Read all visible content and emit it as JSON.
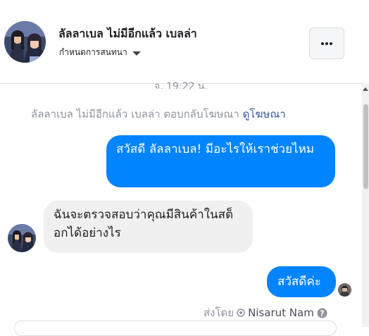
{
  "header": {
    "name": "ลัลลาเบล ไม่มีอีกแล้ว เบลล่า",
    "assign_label": "กำหนดการสนทนา",
    "more_icon": "more-horizontal-icon",
    "caret_icon": "caret-down-icon"
  },
  "thread": {
    "timestamp": "จ. 19:22 น.",
    "ad_reply_text": "ลัลลาเบล ไม่มีอีกแล้ว เบลล่า ตอบกลับโฆษณา",
    "ad_link": "ดูโฆษณา",
    "messages": [
      {
        "from": "page",
        "text": "สวัสดี ลัลลาเบล! มีอะไรให้เราช่วยไหม"
      },
      {
        "from": "customer",
        "text": "ฉันจะตรวจสอบว่าคุณมีสินค้าในสต็อกได้อย่างไร"
      },
      {
        "from": "page",
        "text": "สวัสดีค่ะ"
      }
    ],
    "sent_by_label": "ส่งโดย",
    "sender_name": "Nisarut Nam",
    "help_icon": "help-icon"
  },
  "colors": {
    "outgoing_bubble": "#0084ff",
    "incoming_bubble": "#f1f0f0",
    "link": "#385898",
    "muted_text": "#90949c"
  }
}
